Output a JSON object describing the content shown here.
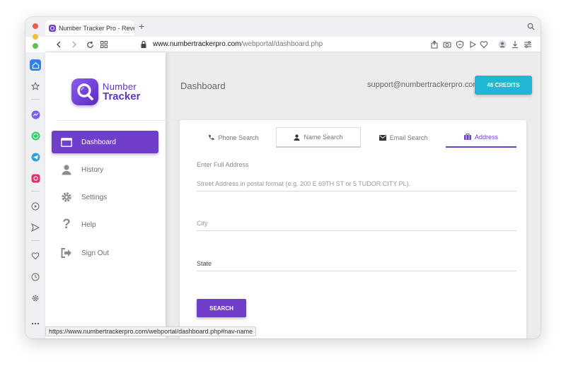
{
  "browser": {
    "tab_title": "Number Tracker Pro - Reverse",
    "url_host": "www.numbertrackerpro.com",
    "url_path": "/webportal/dashboard.php",
    "status_url": "https://www.numbertrackerpro.com/webportal/dashboard.php#nav-name"
  },
  "logo": {
    "line1": "Number",
    "line2": "Tracker"
  },
  "sidebar": {
    "items": [
      {
        "label": "Dashboard",
        "icon": "dashboard-icon",
        "active": true
      },
      {
        "label": "History",
        "icon": "user-icon"
      },
      {
        "label": "Settings",
        "icon": "gear-icon"
      },
      {
        "label": "Help",
        "icon": "question-icon"
      },
      {
        "label": "Sign Out",
        "icon": "sign-out-icon"
      }
    ]
  },
  "header": {
    "title": "Dashboard",
    "support_email": "support@numbertrackerpro.com",
    "credits_label": "46 CREDITS"
  },
  "search_tabs": [
    {
      "label": "Phone Search",
      "icon": "phone-icon"
    },
    {
      "label": "Name Search",
      "icon": "user-icon"
    },
    {
      "label": "Email Search",
      "icon": "envelope-icon"
    },
    {
      "label": "Address",
      "icon": "briefcase-icon",
      "active": true
    }
  ],
  "form": {
    "section_label": "Enter Full Address",
    "street_placeholder": "Street Address in postal format (e.g. 200 E 69TH ST or 5 TUDOR CITY PL).",
    "city_placeholder": "City",
    "state_placeholder": "State",
    "search_label": "SEARCH"
  },
  "colors": {
    "accent": "#6f3fc9",
    "credits": "#1fb7d3"
  }
}
